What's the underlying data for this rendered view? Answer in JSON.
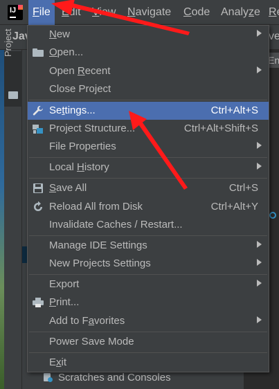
{
  "menubar": {
    "items": [
      {
        "pre": "",
        "mn": "F",
        "post": "ile"
      },
      {
        "pre": "",
        "mn": "E",
        "post": "dit"
      },
      {
        "pre": "",
        "mn": "V",
        "post": "iew"
      },
      {
        "pre": "",
        "mn": "N",
        "post": "avigate"
      },
      {
        "pre": "",
        "mn": "C",
        "post": "ode"
      },
      {
        "pre": "Analy",
        "mn": "z",
        "post": "e"
      },
      {
        "pre": "",
        "mn": "R",
        "post": "e"
      }
    ]
  },
  "background": {
    "project_crumb": "Jav",
    "crumb_right": "ve",
    "project_tab": "Project",
    "right_tab": "En",
    "gutter_number": "10",
    "scratches": "Scratches and Consoles"
  },
  "file_menu": {
    "new": {
      "mn": "N",
      "post": "ew"
    },
    "open": {
      "mn": "O",
      "post": "pen..."
    },
    "open_recent": {
      "pre": "Open ",
      "mn": "R",
      "post": "ecent"
    },
    "close_project": "Close Project",
    "settings": {
      "mn": "",
      "pre": "Se",
      "mn2": "t",
      "post": "tings...",
      "shortcut": "Ctrl+Alt+S"
    },
    "project_structure": {
      "label": "Project Structure...",
      "shortcut": "Ctrl+Alt+Shift+S"
    },
    "file_properties": "File Properties",
    "local_history": {
      "pre": "Local ",
      "mn": "H",
      "post": "istory"
    },
    "save_all": {
      "mn": "S",
      "post": "ave All",
      "shortcut": "Ctrl+S"
    },
    "reload": {
      "label": "Reload All from Disk",
      "shortcut": "Ctrl+Alt+Y"
    },
    "invalidate": "Invalidate Caches / Restart...",
    "manage_ide": "Manage IDE Settings",
    "new_projects": "New Projects Settings",
    "export": "Export",
    "print": {
      "mn": "P",
      "post": "rint..."
    },
    "favorites": {
      "pre": "Add to F",
      "mn": "a",
      "post": "vorites"
    },
    "power_save": "Power Save Mode",
    "exit": {
      "pre": "E",
      "mn": "x",
      "post": "it"
    }
  },
  "colors": {
    "accent": "#4b6eaf",
    "annotation": "#ff0000"
  }
}
